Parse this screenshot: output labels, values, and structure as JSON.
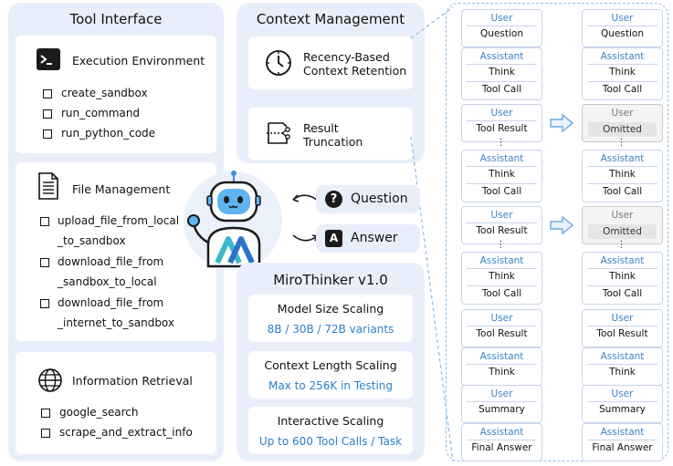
{
  "tool_interface": {
    "title": "Tool Interface",
    "execution": {
      "title": "Execution Environment",
      "items": [
        "create_sandbox",
        "run_command",
        "run_python_code"
      ]
    },
    "file": {
      "title": "File Management",
      "items": [
        [
          "upload_file_from_local",
          "_to_sandbox"
        ],
        [
          "download_file_from",
          "_sandbox_to_local"
        ],
        [
          "download_file_from",
          "_internet_to_sandbox"
        ]
      ]
    },
    "retrieval": {
      "title": "Information Retrieval",
      "items": [
        "google_search",
        "scrape_and_extract_info"
      ]
    }
  },
  "context": {
    "title": "Context Management",
    "recency": [
      "Recency-Based",
      "Context Retention"
    ],
    "result": [
      "Result",
      "Truncation"
    ]
  },
  "agent": {
    "question": "Question",
    "answer": "Answer",
    "question_glyph": "?",
    "answer_glyph": "A"
  },
  "mirothinker": {
    "title": "MiroThinker v1.0",
    "cards": [
      {
        "title": "Model Size Scaling",
        "value": "8B / 30B / 72B variants"
      },
      {
        "title": "Context Length Scaling",
        "value": "Max to 256K in Testing"
      },
      {
        "title": "Interactive Scaling",
        "value": "Up to 600 Tool Calls / Task"
      }
    ]
  },
  "trajectory": {
    "left": [
      {
        "role": "User",
        "lines": [
          "Question"
        ]
      },
      {
        "role": "Assistant",
        "lines": [
          "Think",
          "Tool Call"
        ]
      },
      {
        "role": "User",
        "lines": [
          "Tool Result"
        ]
      },
      {
        "role": "Assistant",
        "lines": [
          "Think",
          "Tool Call"
        ]
      },
      {
        "role": "User",
        "lines": [
          "Tool Result"
        ]
      },
      {
        "role": "Assistant",
        "lines": [
          "Think",
          "Tool Call"
        ]
      },
      {
        "role": "User",
        "lines": [
          "Tool Result"
        ]
      },
      {
        "role": "Assistant",
        "lines": [
          "Think"
        ]
      },
      {
        "role": "User",
        "lines": [
          "Summary"
        ]
      },
      {
        "role": "Assistant",
        "lines": [
          "Final Answer"
        ]
      }
    ],
    "right": [
      {
        "role": "User",
        "lines": [
          "Question"
        ]
      },
      {
        "role": "Assistant",
        "lines": [
          "Think",
          "Tool Call"
        ]
      },
      {
        "role": "User",
        "lines": [
          "Omitted"
        ],
        "omitted": true
      },
      {
        "role": "Assistant",
        "lines": [
          "Think",
          "Tool Call"
        ]
      },
      {
        "role": "User",
        "lines": [
          "Omitted"
        ],
        "omitted": true
      },
      {
        "role": "Assistant",
        "lines": [
          "Think",
          "Tool Call"
        ]
      },
      {
        "role": "User",
        "lines": [
          "Tool Result"
        ]
      },
      {
        "role": "Assistant",
        "lines": [
          "Think"
        ]
      },
      {
        "role": "User",
        "lines": [
          "Summary"
        ]
      },
      {
        "role": "Assistant",
        "lines": [
          "Final Answer"
        ]
      }
    ]
  },
  "colors": {
    "panel_bg": "#e9effa",
    "accent_blue": "#2a7fc9",
    "robot_blue": "#5db4f0",
    "dashed_border": "#8bbce6"
  }
}
